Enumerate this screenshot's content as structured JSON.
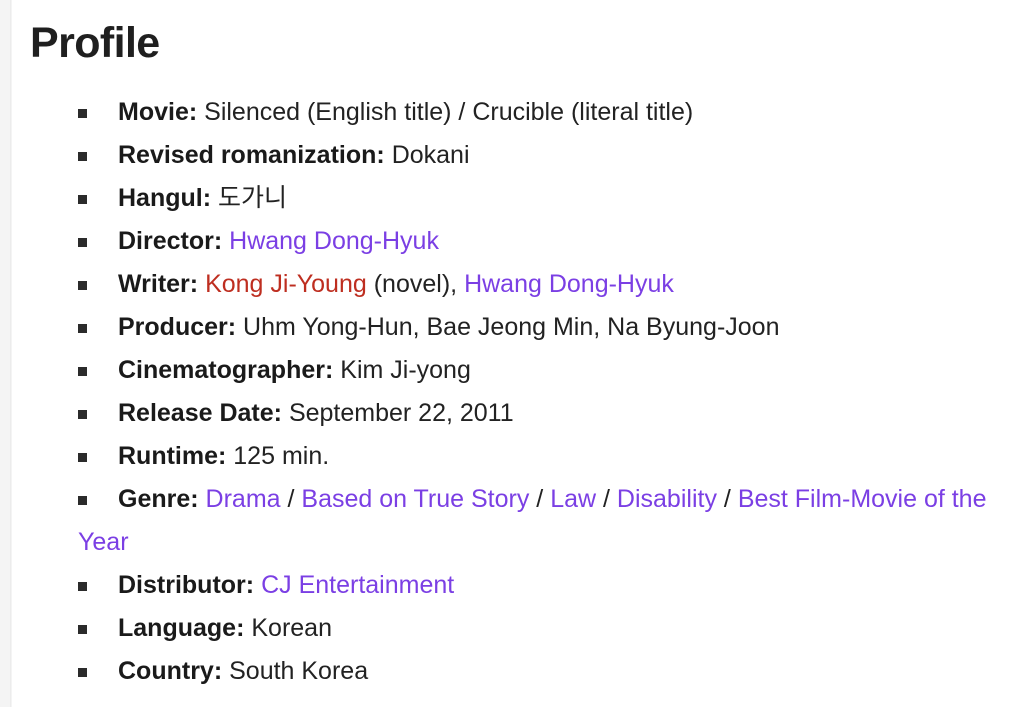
{
  "page": {
    "title": "Profile",
    "background": "#ffffff",
    "gutter_color": "#f4f4f4",
    "text_color": "#222222",
    "link_color": "#7B3FE4",
    "link_alt_color": "#BE2E20",
    "bullet_color": "#2b2b2b"
  },
  "fields": {
    "movie": {
      "label": "Movie:",
      "value": "Silenced (English title) / Crucible (literal title)"
    },
    "revised_romanization": {
      "label": "Revised romanization:",
      "value": "Dokani"
    },
    "hangul": {
      "label": "Hangul:",
      "value": "도가니"
    },
    "director": {
      "label": "Director:",
      "links": [
        {
          "text": "Hwang Dong-Hyuk",
          "style": "link"
        }
      ]
    },
    "writer": {
      "label": "Writer:",
      "novel_author": "Kong Ji-Young",
      "novel_note": "(novel),",
      "adapter": "Hwang Dong-Hyuk"
    },
    "producer": {
      "label": "Producer:",
      "value": "Uhm Yong-Hun, Bae Jeong Min, Na Byung-Joon"
    },
    "cinematographer": {
      "label": "Cinematographer:",
      "value": "Kim Ji-yong"
    },
    "release_date": {
      "label": "Release Date:",
      "value": "September 22, 2011"
    },
    "runtime": {
      "label": "Runtime:",
      "value": "125 min."
    },
    "genre": {
      "label": "Genre:",
      "items": [
        "Drama",
        "Based on True Story",
        "Law",
        "Disability",
        "Best Film-Movie of the Year"
      ],
      "separator": "/"
    },
    "distributor": {
      "label": "Distributor:",
      "value": "CJ Entertainment"
    },
    "language": {
      "label": "Language:",
      "value": "Korean"
    },
    "country": {
      "label": "Country:",
      "value": "South Korea"
    }
  }
}
